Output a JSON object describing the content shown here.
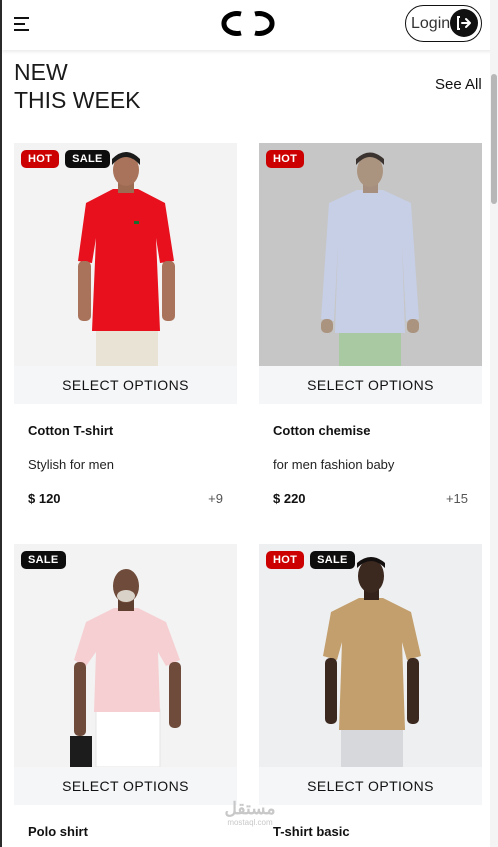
{
  "header": {
    "login_label": "Login",
    "icons": {
      "menu": "hamburger-menu-icon",
      "logo": "chanel-logo",
      "login": "login-arrow-icon"
    }
  },
  "section": {
    "title_line1": "NEW",
    "title_line2": "THIS WEEK",
    "see_all": "See All"
  },
  "badge_labels": {
    "hot": "HOT",
    "sale": "SALE"
  },
  "products": [
    {
      "name": "Cotton T-shirt",
      "description": "Stylish for men",
      "price": "$ 120",
      "variants": "+9",
      "badges": [
        "HOT",
        "SALE"
      ],
      "action": "SELECT OPTIONS",
      "shirt_color": "#e8101d"
    },
    {
      "name": "Cotton chemise",
      "description": "for men fashion baby",
      "price": "$ 220",
      "variants": "+15",
      "badges": [
        "HOT"
      ],
      "action": "SELECT OPTIONS",
      "shirt_color": "#c7cfe6"
    },
    {
      "name": "Polo shirt",
      "description": "",
      "price": "",
      "variants": "",
      "badges": [
        "SALE"
      ],
      "action": "SELECT OPTIONS",
      "shirt_color": "#f6cfd2"
    },
    {
      "name": "T-shirt basic",
      "description": "",
      "price": "",
      "variants": "",
      "badges": [
        "HOT",
        "SALE"
      ],
      "action": "SELECT OPTIONS",
      "shirt_color": "#c29f6c"
    }
  ],
  "watermark": {
    "line1": "مستقل",
    "line2": "mostaql.com"
  }
}
